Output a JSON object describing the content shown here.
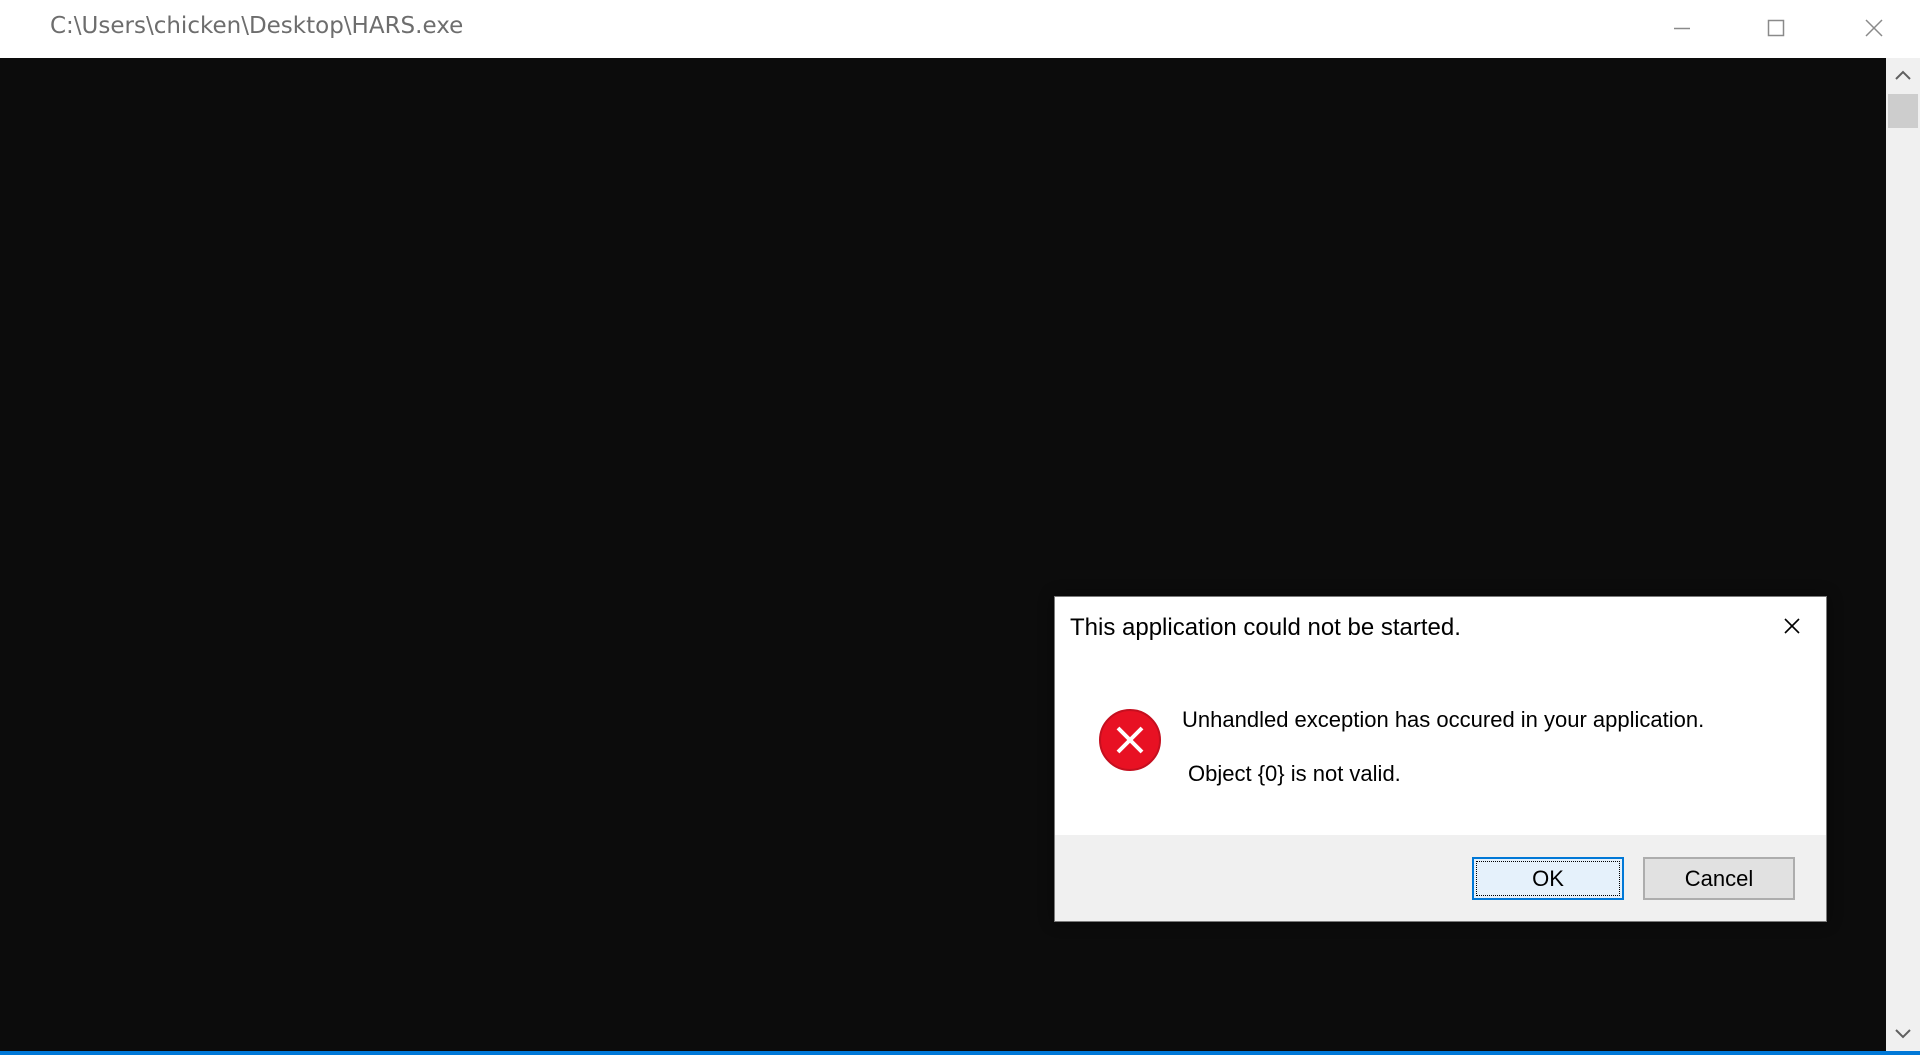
{
  "window": {
    "title": "C:\\Users\\chicken\\Desktop\\HARS.exe",
    "controls": [
      "minimize-icon",
      "maximize-icon",
      "close-icon"
    ]
  },
  "console": {
    "background": "#0c0c0c"
  },
  "scrollbar": {
    "up_icon": "chevron-up-icon",
    "down_icon": "chevron-down-icon"
  },
  "dialog": {
    "title": "This application could not be started.",
    "icon": "error-icon",
    "message": "Unhandled exception has occured in your application.",
    "detail": "Object {0} is not valid.",
    "buttons": {
      "ok": "OK",
      "cancel": "Cancel"
    },
    "colors": {
      "error_red": "#e81123",
      "focus_blue": "#0078d7"
    }
  }
}
